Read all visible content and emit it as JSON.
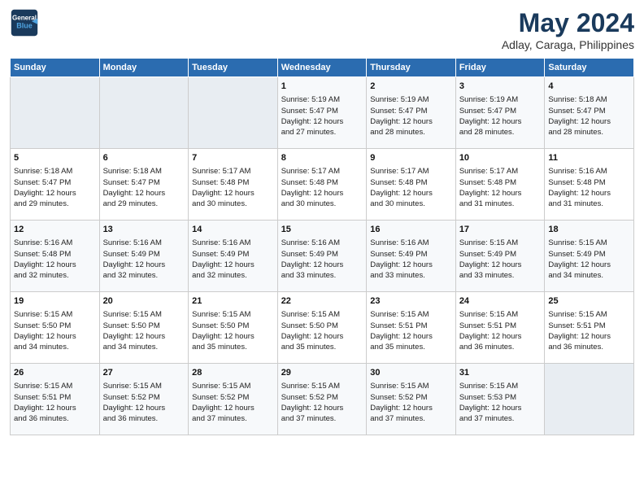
{
  "header": {
    "logo_line1": "General",
    "logo_line2": "Blue",
    "month": "May 2024",
    "location": "Adlay, Caraga, Philippines"
  },
  "weekdays": [
    "Sunday",
    "Monday",
    "Tuesday",
    "Wednesday",
    "Thursday",
    "Friday",
    "Saturday"
  ],
  "weeks": [
    [
      {
        "day": "",
        "info": ""
      },
      {
        "day": "",
        "info": ""
      },
      {
        "day": "",
        "info": ""
      },
      {
        "day": "1",
        "info": "Sunrise: 5:19 AM\nSunset: 5:47 PM\nDaylight: 12 hours\nand 27 minutes."
      },
      {
        "day": "2",
        "info": "Sunrise: 5:19 AM\nSunset: 5:47 PM\nDaylight: 12 hours\nand 28 minutes."
      },
      {
        "day": "3",
        "info": "Sunrise: 5:19 AM\nSunset: 5:47 PM\nDaylight: 12 hours\nand 28 minutes."
      },
      {
        "day": "4",
        "info": "Sunrise: 5:18 AM\nSunset: 5:47 PM\nDaylight: 12 hours\nand 28 minutes."
      }
    ],
    [
      {
        "day": "5",
        "info": "Sunrise: 5:18 AM\nSunset: 5:47 PM\nDaylight: 12 hours\nand 29 minutes."
      },
      {
        "day": "6",
        "info": "Sunrise: 5:18 AM\nSunset: 5:47 PM\nDaylight: 12 hours\nand 29 minutes."
      },
      {
        "day": "7",
        "info": "Sunrise: 5:17 AM\nSunset: 5:48 PM\nDaylight: 12 hours\nand 30 minutes."
      },
      {
        "day": "8",
        "info": "Sunrise: 5:17 AM\nSunset: 5:48 PM\nDaylight: 12 hours\nand 30 minutes."
      },
      {
        "day": "9",
        "info": "Sunrise: 5:17 AM\nSunset: 5:48 PM\nDaylight: 12 hours\nand 30 minutes."
      },
      {
        "day": "10",
        "info": "Sunrise: 5:17 AM\nSunset: 5:48 PM\nDaylight: 12 hours\nand 31 minutes."
      },
      {
        "day": "11",
        "info": "Sunrise: 5:16 AM\nSunset: 5:48 PM\nDaylight: 12 hours\nand 31 minutes."
      }
    ],
    [
      {
        "day": "12",
        "info": "Sunrise: 5:16 AM\nSunset: 5:48 PM\nDaylight: 12 hours\nand 32 minutes."
      },
      {
        "day": "13",
        "info": "Sunrise: 5:16 AM\nSunset: 5:49 PM\nDaylight: 12 hours\nand 32 minutes."
      },
      {
        "day": "14",
        "info": "Sunrise: 5:16 AM\nSunset: 5:49 PM\nDaylight: 12 hours\nand 32 minutes."
      },
      {
        "day": "15",
        "info": "Sunrise: 5:16 AM\nSunset: 5:49 PM\nDaylight: 12 hours\nand 33 minutes."
      },
      {
        "day": "16",
        "info": "Sunrise: 5:16 AM\nSunset: 5:49 PM\nDaylight: 12 hours\nand 33 minutes."
      },
      {
        "day": "17",
        "info": "Sunrise: 5:15 AM\nSunset: 5:49 PM\nDaylight: 12 hours\nand 33 minutes."
      },
      {
        "day": "18",
        "info": "Sunrise: 5:15 AM\nSunset: 5:49 PM\nDaylight: 12 hours\nand 34 minutes."
      }
    ],
    [
      {
        "day": "19",
        "info": "Sunrise: 5:15 AM\nSunset: 5:50 PM\nDaylight: 12 hours\nand 34 minutes."
      },
      {
        "day": "20",
        "info": "Sunrise: 5:15 AM\nSunset: 5:50 PM\nDaylight: 12 hours\nand 34 minutes."
      },
      {
        "day": "21",
        "info": "Sunrise: 5:15 AM\nSunset: 5:50 PM\nDaylight: 12 hours\nand 35 minutes."
      },
      {
        "day": "22",
        "info": "Sunrise: 5:15 AM\nSunset: 5:50 PM\nDaylight: 12 hours\nand 35 minutes."
      },
      {
        "day": "23",
        "info": "Sunrise: 5:15 AM\nSunset: 5:51 PM\nDaylight: 12 hours\nand 35 minutes."
      },
      {
        "day": "24",
        "info": "Sunrise: 5:15 AM\nSunset: 5:51 PM\nDaylight: 12 hours\nand 36 minutes."
      },
      {
        "day": "25",
        "info": "Sunrise: 5:15 AM\nSunset: 5:51 PM\nDaylight: 12 hours\nand 36 minutes."
      }
    ],
    [
      {
        "day": "26",
        "info": "Sunrise: 5:15 AM\nSunset: 5:51 PM\nDaylight: 12 hours\nand 36 minutes."
      },
      {
        "day": "27",
        "info": "Sunrise: 5:15 AM\nSunset: 5:52 PM\nDaylight: 12 hours\nand 36 minutes."
      },
      {
        "day": "28",
        "info": "Sunrise: 5:15 AM\nSunset: 5:52 PM\nDaylight: 12 hours\nand 37 minutes."
      },
      {
        "day": "29",
        "info": "Sunrise: 5:15 AM\nSunset: 5:52 PM\nDaylight: 12 hours\nand 37 minutes."
      },
      {
        "day": "30",
        "info": "Sunrise: 5:15 AM\nSunset: 5:52 PM\nDaylight: 12 hours\nand 37 minutes."
      },
      {
        "day": "31",
        "info": "Sunrise: 5:15 AM\nSunset: 5:53 PM\nDaylight: 12 hours\nand 37 minutes."
      },
      {
        "day": "",
        "info": ""
      }
    ]
  ]
}
